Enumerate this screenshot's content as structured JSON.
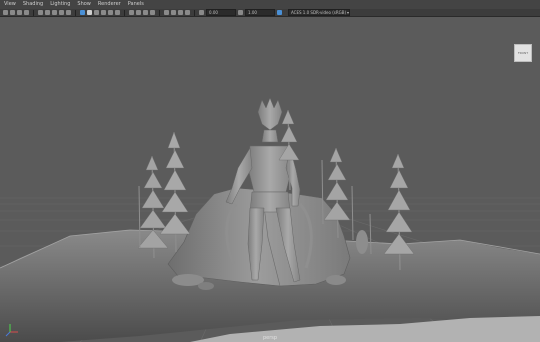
{
  "menu": {
    "items": [
      "View",
      "Shading",
      "Lighting",
      "Show",
      "Renderer",
      "Panels"
    ]
  },
  "toolbar": {
    "field_left": "0.00",
    "field_right": "1.00",
    "colorspace": "ACES 1.0 SDR-video (sRGB)"
  },
  "viewport": {
    "camera_label": "persp",
    "viewcube_face": "FRONT",
    "axis_icon": "xyz-axis-icon"
  },
  "colors": {
    "menubar": "#444444",
    "toolbar": "#3c3c3c",
    "viewport_bg": "#5b5b5b",
    "model": "#9b9b9b",
    "accent": "#4a90d6"
  }
}
